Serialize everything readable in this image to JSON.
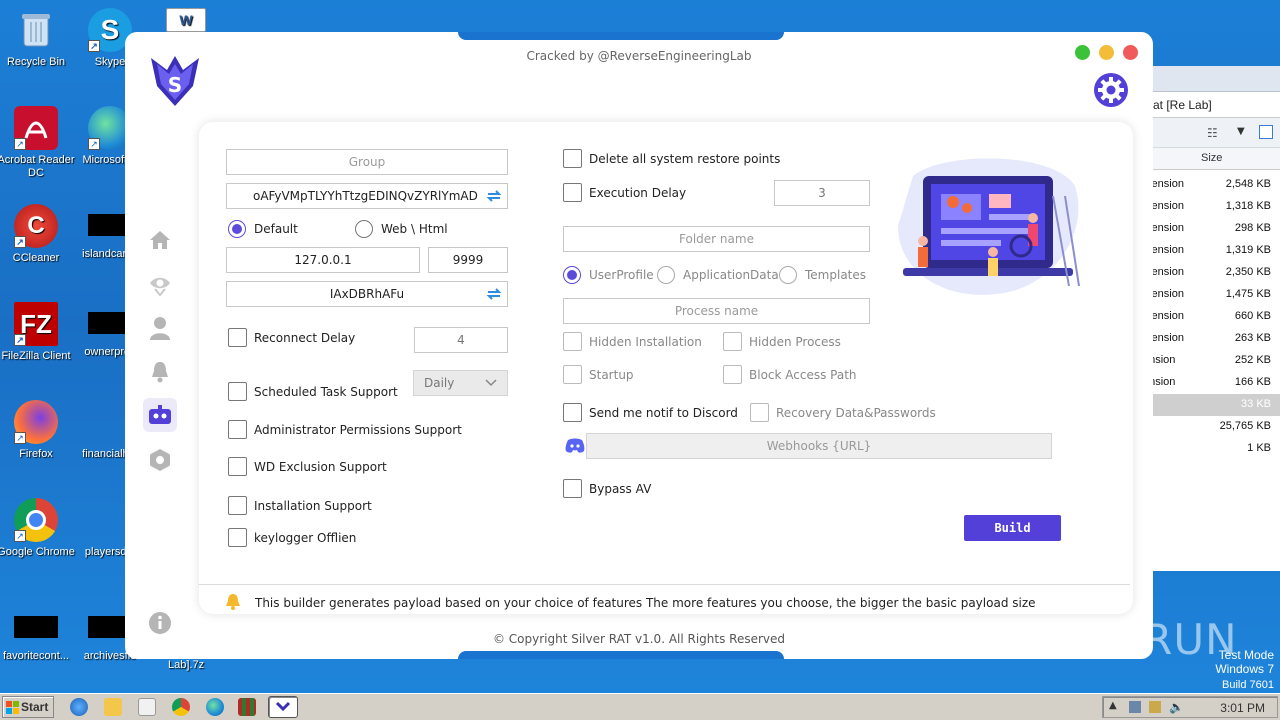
{
  "desktop": {
    "icons": [
      {
        "label": "Recycle Bin"
      },
      {
        "label": "Skype"
      },
      {
        "label": "Acrobat Reader DC"
      },
      {
        "label": "Microsoft E"
      },
      {
        "label": "CCleaner"
      },
      {
        "label": "islandcard.j"
      },
      {
        "label": "FileZilla Client"
      },
      {
        "label": "ownerpres"
      },
      {
        "label": "Firefox"
      },
      {
        "label": "financialhot"
      },
      {
        "label": "Google Chrome"
      },
      {
        "label": "playersdie"
      },
      {
        "label": "favoritecont..."
      },
      {
        "label": "archivesflo"
      }
    ],
    "bg_label": "Lab].7z",
    "watermark_brand": "ANY RUN",
    "os_watermark": [
      "Test Mode",
      "Windows 7",
      "Build 7601"
    ]
  },
  "explorer": {
    "address": "at [Re Lab]",
    "column": "Size",
    "rows": [
      {
        "name": "xtension",
        "size": "2,548 KB"
      },
      {
        "name": "xtension",
        "size": "1,318 KB"
      },
      {
        "name": "xtension",
        "size": "298 KB"
      },
      {
        "name": "xtension",
        "size": "1,319 KB"
      },
      {
        "name": "xtension",
        "size": "2,350 KB"
      },
      {
        "name": "xtension",
        "size": "1,475 KB"
      },
      {
        "name": "xtension",
        "size": "660 KB"
      },
      {
        "name": "xtension",
        "size": "263 KB"
      },
      {
        "name": "ension",
        "size": "252 KB"
      },
      {
        "name": "ension",
        "size": "166 KB"
      },
      {
        "name": "",
        "size": "33 KB"
      },
      {
        "name": "",
        "size": "25,765 KB"
      },
      {
        "name": "",
        "size": "1 KB"
      }
    ]
  },
  "app": {
    "title": "Cracked by @ReverseEngineeringLab",
    "logo_letter": "S",
    "colors": {
      "accent": "#5340d9",
      "green": "#3cc13b",
      "yellow": "#f3bd3a",
      "red": "#f05a5a"
    },
    "sidebar": [
      "home-icon",
      "eye-icon",
      "user-icon",
      "bell-icon",
      "robot-icon",
      "hexagon-icon",
      "info-icon"
    ],
    "left": {
      "group_placeholder": "Group",
      "mutex": "oAFyVMpTLYYhTtzgEDINQvZYRlYmAD",
      "radio_default": "Default",
      "radio_web": "Web \\ Html",
      "host": "127.0.0.1",
      "port": "9999",
      "key": "IAxDBRhAFu",
      "reconnect_label": "Reconnect Delay",
      "reconnect_value": "4",
      "scheduled_label": "Scheduled Task Support",
      "schedule_value": "Daily",
      "admin_label": "Administrator Permissions Support",
      "wd_label": "WD Exclusion Support",
      "install_label": "Installation Support",
      "keylogger_label": "keylogger Offlien"
    },
    "right": {
      "restore_label": "Delete all system restore points",
      "exec_delay_label": "Execution Delay",
      "exec_delay_value": "3",
      "folder_placeholder": "Folder name",
      "radio_userprofile": "UserProfile",
      "radio_appdata": "ApplicationData",
      "radio_templates": "Templates",
      "process_placeholder": "Process name",
      "hidden_install": "Hidden Installation",
      "hidden_process": "Hidden Process",
      "startup": "Startup",
      "block_access": "Block Access Path",
      "discord_notif": "Send me notif to Discord",
      "recovery": "Recovery Data&Passwords",
      "webhook_placeholder": "Webhooks {URL}",
      "bypass_av": "Bypass AV",
      "build": "Build"
    },
    "info_text": "This builder generates payload based on your choice of features The more features you choose, the bigger the basic payload size",
    "copyright": "© Copyright Silver RAT v1.0. All Rights Reserved"
  },
  "taskbar": {
    "start": "Start",
    "clock": "3:01 PM"
  }
}
